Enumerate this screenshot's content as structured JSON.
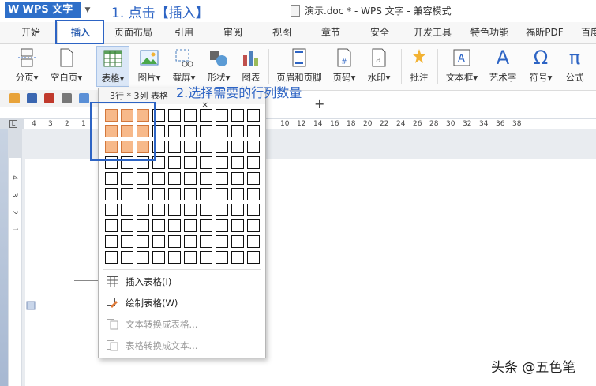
{
  "titlebar": {
    "app_menu": "WPS 文字",
    "doc_title": "演示.doc * - WPS 文字 - 兼容模式"
  },
  "tabs": [
    "开始",
    "插入",
    "页面布局",
    "引用",
    "审阅",
    "视图",
    "章节",
    "安全",
    "开发工具",
    "特色功能",
    "福昕PDF",
    "百度"
  ],
  "ribbon": {
    "page_break": "分页",
    "blank_page": "空白页",
    "table": "表格",
    "picture": "图片",
    "screenshot": "截屏",
    "shapes": "形状",
    "chart": "图表",
    "header_footer": "页眉和页脚",
    "page_number": "页码",
    "watermark": "水印",
    "comment": "批注",
    "textbox": "文本框",
    "wordart": "艺术字",
    "symbol": "符号",
    "formula": "公式",
    "dropdown_mark": "▾",
    "symbol_omega": "Ω",
    "formula_pi": "π",
    "wordart_a": "A"
  },
  "ruler": {
    "h_ticks": [
      "4",
      "3",
      "2",
      "1",
      "",
      "",
      "",
      "",
      "",
      "",
      "",
      "",
      "",
      "",
      "",
      "10",
      "12",
      "14",
      "16",
      "18",
      "20",
      "22",
      "24",
      "26",
      "28",
      "30",
      "32",
      "34",
      "36",
      "38"
    ],
    "v_ticks": [
      "4",
      "3",
      "2",
      "1"
    ]
  },
  "dropdown": {
    "size_label": "3行 * 3列 表格",
    "close": "×",
    "rows": 10,
    "cols": 10,
    "selected_rows": 3,
    "selected_cols": 3,
    "items": [
      {
        "label": "插入表格(I)",
        "disabled": false
      },
      {
        "label": "绘制表格(W)",
        "disabled": false
      },
      {
        "label": "文本转换成表格...",
        "disabled": true
      },
      {
        "label": "表格转换成文本...",
        "disabled": true
      }
    ]
  },
  "annotations": {
    "step1": "1. 点击【插入】",
    "step2": "2.选择需要的行列数量"
  },
  "watermark": "头条 @五色笔",
  "plus": "+",
  "colors": {
    "accent": "#2d64c4",
    "selected_cell": "#f7b98a",
    "wps_blue": "#2e6fc9"
  }
}
